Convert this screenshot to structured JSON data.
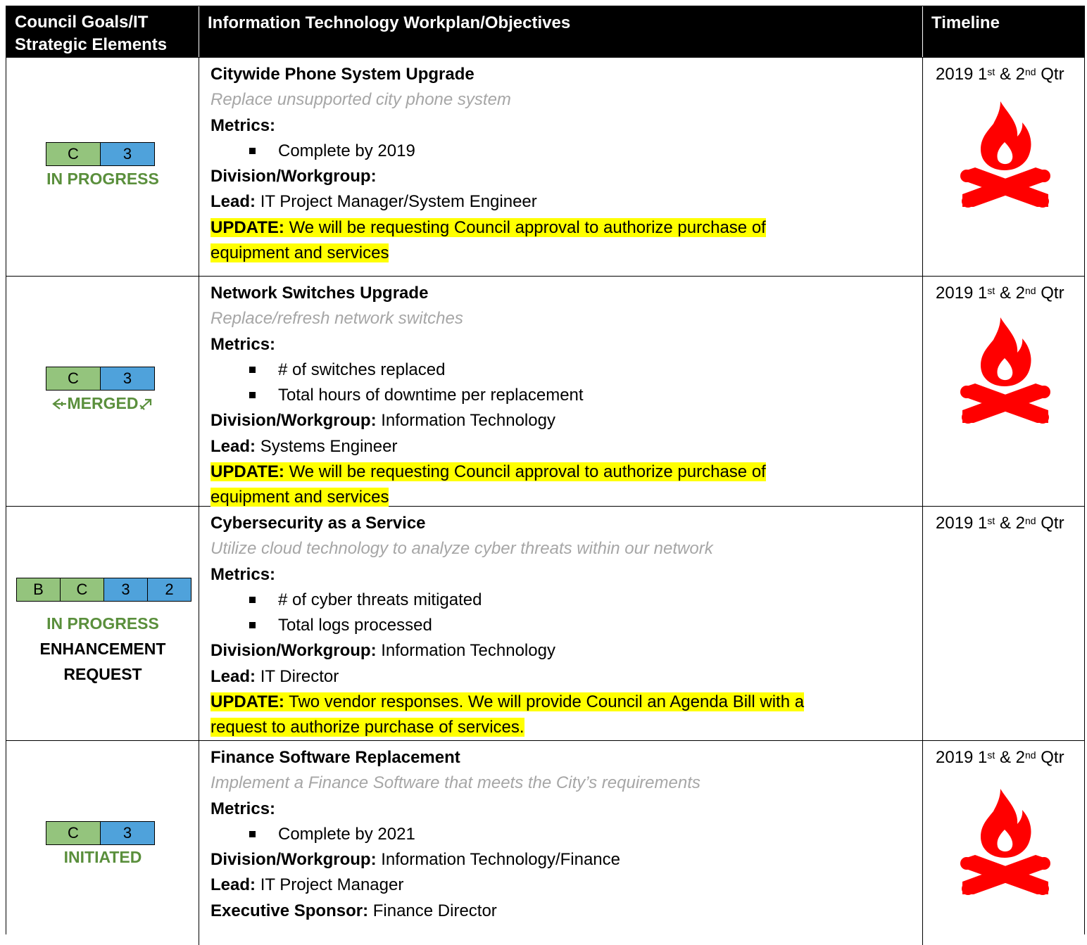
{
  "header": {
    "col1": "Council Goals/IT Strategic Elements",
    "col1_line1": "Council Goals/IT",
    "col1_line2": "Strategic Elements",
    "col2": "Information Technology Workplan/Objectives",
    "col3": "Timeline"
  },
  "rows": [
    {
      "badges": [
        "C",
        "3"
      ],
      "status": "IN PROGRESS",
      "title": "Citywide Phone System Upgrade",
      "subtitle": "Replace unsupported city phone system",
      "metrics_label": "Metrics:",
      "metrics": [
        "Complete by 2019"
      ],
      "division_label": "Division/Workgroup:",
      "division": "",
      "lead_label": "Lead:",
      "lead": "IT Project Manager/System Engineer",
      "update_label": "UPDATE:",
      "update_line1": "We will be requesting Council approval to authorize purchase of",
      "update_line2": "equipment and services",
      "timeline_year": "2019 1",
      "timeline_sup1": "st",
      "timeline_mid": " & 2",
      "timeline_sup2": "nd",
      "timeline_end": " Qtr",
      "icon": "campfire-icon"
    },
    {
      "badges": [
        "C",
        "3"
      ],
      "status": "MERGED",
      "title": "Network Switches Upgrade",
      "subtitle": "Replace/refresh network switches",
      "metrics_label": "Metrics:",
      "metrics": [
        "# of switches replaced",
        "Total hours of downtime per replacement"
      ],
      "division_label": "Division/Workgroup:",
      "division": "Information Technology",
      "lead_label": "Lead:",
      "lead": "Systems Engineer",
      "update_label": "UPDATE:",
      "update_line1": "We will be requesting Council approval to authorize purchase of",
      "update_line2": "equipment and services",
      "timeline_year": "2019 1",
      "timeline_sup1": "st",
      "timeline_mid": " & 2",
      "timeline_sup2": "nd",
      "timeline_end": " Qtr",
      "icon": "campfire-icon"
    },
    {
      "badges": [
        "B",
        "C",
        "3",
        "2"
      ],
      "status": "IN PROGRESS",
      "status2": "ENHANCEMENT",
      "status3": "REQUEST",
      "title": "Cybersecurity as a Service",
      "subtitle": "Utilize cloud technology to analyze cyber threats within our network",
      "metrics_label": "Metrics:",
      "metrics": [
        "# of cyber threats mitigated",
        "Total logs processed"
      ],
      "division_label": "Division/Workgroup:",
      "division": "Information Technology",
      "lead_label": "Lead:",
      "lead": "IT Director",
      "update_label": "UPDATE:",
      "update_line1": "Two vendor responses. We will provide Council an Agenda Bill with a",
      "update_line2": "request to authorize purchase of services.",
      "timeline_year": "2019 1",
      "timeline_sup1": "st",
      "timeline_mid": " & 2",
      "timeline_sup2": "nd",
      "timeline_end": " Qtr"
    },
    {
      "badges": [
        "C",
        "3"
      ],
      "status": "INITIATED",
      "title": "Finance Software Replacement",
      "subtitle": "Implement a Finance Software that meets the City’s requirements",
      "metrics_label": "Metrics:",
      "metrics": [
        "Complete by 2021"
      ],
      "division_label": "Division/Workgroup:",
      "division": "Information Technology/Finance",
      "lead_label": "Lead:",
      "lead": "IT Project Manager",
      "sponsor_label": "Executive Sponsor:",
      "sponsor": "Finance Director",
      "timeline_year": "2019 1",
      "timeline_sup1": "st",
      "timeline_mid": " & 2",
      "timeline_sup2": "nd",
      "timeline_end": " Qtr",
      "icon": "campfire-icon"
    }
  ],
  "colors": {
    "badge_green": "#94c47d",
    "badge_blue": "#4fa2db",
    "status_green": "#5a8f3c",
    "highlight": "#ffff00",
    "fire_red": "#ff0000",
    "subtitle_gray": "#a6a6a6"
  }
}
